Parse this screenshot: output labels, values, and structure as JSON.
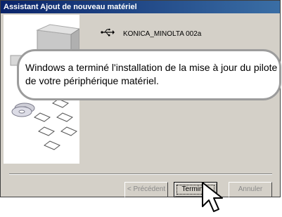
{
  "window": {
    "title": "Assistant Ajout de nouveau matériel"
  },
  "device": {
    "name": "KONICA_MINOLTA 002a",
    "icon": "usb-icon"
  },
  "message": {
    "line1": "Windows a terminé l'installation de la mise à jour du pilote",
    "line2": "de votre périphérique matériel."
  },
  "buttons": {
    "back": {
      "label": "< Précédent",
      "enabled": false
    },
    "finish": {
      "label": "Terminer",
      "enabled": true
    },
    "cancel": {
      "label": "Annuler",
      "enabled": false
    }
  },
  "colors": {
    "titlebar_start": "#0a246a",
    "titlebar_end": "#3a6ea5",
    "dialog_bg": "#d4d0c8"
  },
  "icons": [
    "usb-icon",
    "computer-icon",
    "cd-icon",
    "floppy-disk-icon",
    "mouse-cursor-icon"
  ]
}
